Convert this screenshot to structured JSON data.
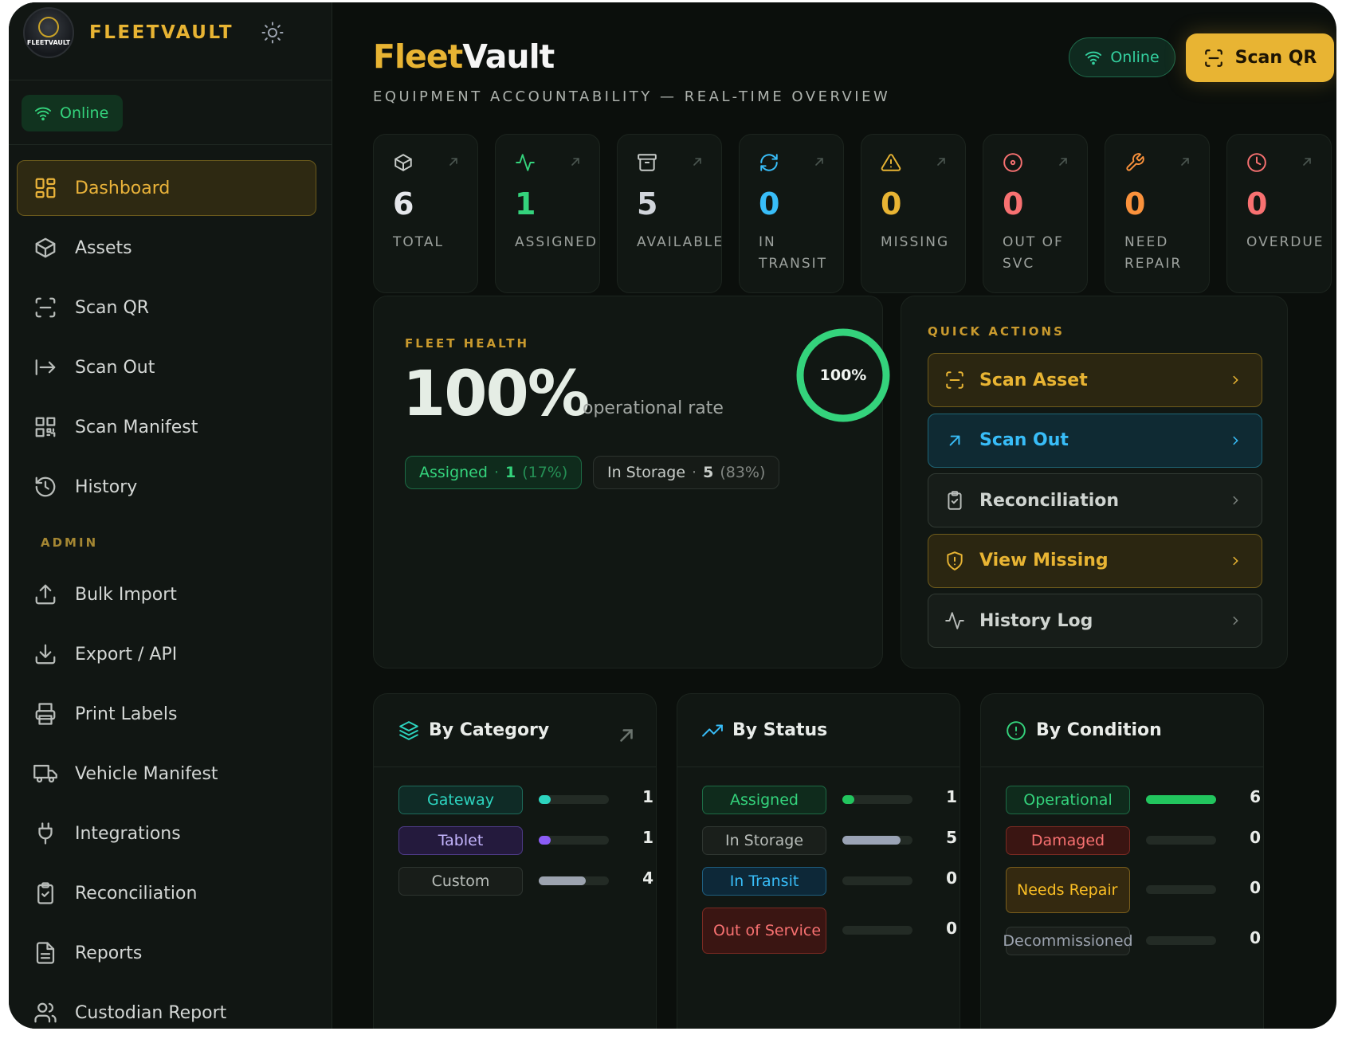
{
  "brand": {
    "name": "FLEETVAULT",
    "logo_text": "FLEETVAULT"
  },
  "sidebar": {
    "status": "Online",
    "items": [
      {
        "label": "Dashboard",
        "icon": "dashboard-icon",
        "active": true
      },
      {
        "label": "Assets",
        "icon": "box-icon"
      },
      {
        "label": "Scan QR",
        "icon": "scan-icon"
      },
      {
        "label": "Scan Out",
        "icon": "arrow-right-bar-icon"
      },
      {
        "label": "Scan Manifest",
        "icon": "qr-icon"
      },
      {
        "label": "History",
        "icon": "history-icon"
      }
    ],
    "admin_label": "ADMIN",
    "admin_items": [
      {
        "label": "Bulk Import",
        "icon": "upload-icon"
      },
      {
        "label": "Export / API",
        "icon": "download-icon"
      },
      {
        "label": "Print Labels",
        "icon": "printer-icon"
      },
      {
        "label": "Vehicle Manifest",
        "icon": "truck-icon"
      },
      {
        "label": "Integrations",
        "icon": "plug-icon"
      },
      {
        "label": "Reconciliation",
        "icon": "clipboard-icon"
      },
      {
        "label": "Reports",
        "icon": "file-icon"
      },
      {
        "label": "Custodian Report",
        "icon": "users-icon"
      }
    ]
  },
  "header": {
    "title_a": "Fleet",
    "title_b": "Vault",
    "subtitle": "EQUIPMENT ACCOUNTABILITY — REAL-TIME OVERVIEW",
    "status": "Online",
    "scan_label": "Scan QR"
  },
  "stats": [
    {
      "value": "6",
      "label": "TOTAL",
      "color": "#e5e7eb",
      "icon": "box-icon"
    },
    {
      "value": "1",
      "label": "ASSIGNED",
      "color": "#34d37c",
      "icon": "activity-icon"
    },
    {
      "value": "5",
      "label": "AVAILABLE",
      "color": "#d1d5db",
      "icon": "archive-icon"
    },
    {
      "value": "0",
      "label": "IN TRANSIT",
      "color": "#38bdf8",
      "icon": "refresh-icon"
    },
    {
      "value": "0",
      "label": "MISSING",
      "color": "#e8b433",
      "icon": "warning-icon"
    },
    {
      "value": "0",
      "label": "OUT OF SVC",
      "color": "#f87171",
      "icon": "target-icon"
    },
    {
      "value": "0",
      "label": "NEED REPAIR",
      "color": "#fb923c",
      "icon": "wrench-icon"
    },
    {
      "value": "0",
      "label": "OVERDUE",
      "color": "#f87171",
      "icon": "clock-icon"
    }
  ],
  "fleet_health": {
    "label": "FLEET HEALTH",
    "value": "100%",
    "sub": "operational rate",
    "ring_label": "100%",
    "ring_fraction": 1.0,
    "assigned": {
      "name": "Assigned",
      "count": "1",
      "pct": "(17%)"
    },
    "storage": {
      "name": "In Storage",
      "count": "5",
      "pct": "(83%)"
    },
    "dot": "·"
  },
  "quick_actions": {
    "label": "QUICK ACTIONS",
    "items": [
      {
        "label": "Scan Asset",
        "icon": "scan-icon",
        "style": "y"
      },
      {
        "label": "Scan Out",
        "icon": "arrow-up-right-icon",
        "style": "b"
      },
      {
        "label": "Reconciliation",
        "icon": "clipboard-icon",
        "style": "n"
      },
      {
        "label": "View Missing",
        "icon": "shield-alert-icon",
        "style": "y"
      },
      {
        "label": "History Log",
        "icon": "activity-icon",
        "style": "n"
      }
    ]
  },
  "by_category": {
    "title": "By Category",
    "rows": [
      {
        "name": "Gateway",
        "count": "1",
        "fraction": 0.17,
        "bg": "#0f2b26",
        "border": "#1e6b5b",
        "color": "#2dd4bf",
        "bar": "#2dd4bf"
      },
      {
        "name": "Tablet",
        "count": "1",
        "fraction": 0.17,
        "bg": "#241a3d",
        "border": "#4c3a85",
        "color": "#c4b5fd",
        "bar": "#8b5cf6"
      },
      {
        "name": "Custom",
        "count": "4",
        "fraction": 0.67,
        "bg": "#181d19",
        "border": "#2e3530",
        "color": "#b8bdb9",
        "bar": "#9ca3af"
      }
    ]
  },
  "by_status": {
    "title": "By Status",
    "rows": [
      {
        "name": "Assigned",
        "count": "1",
        "fraction": 0.17,
        "bg": "#0f2b1c",
        "border": "#1d6b45",
        "color": "#34d37c",
        "bar": "#22c55e"
      },
      {
        "name": "In Storage",
        "count": "5",
        "fraction": 0.83,
        "bg": "#1a1f1b",
        "border": "#2f3631",
        "color": "#b8bdb9",
        "bar": "#9aa3b5"
      },
      {
        "name": "In Transit",
        "count": "0",
        "fraction": 0,
        "bg": "#0d2838",
        "border": "#1f5e80",
        "color": "#38bdf8",
        "bar": "#38bdf8"
      },
      {
        "name": "Out of Service",
        "count": "0",
        "fraction": 0,
        "bg": "#3a1512",
        "border": "#7a2a22",
        "color": "#f87171",
        "bar": "#f87171"
      }
    ]
  },
  "by_condition": {
    "title": "By Condition",
    "rows": [
      {
        "name": "Operational",
        "count": "6",
        "fraction": 1.0,
        "bg": "#0f2b1c",
        "border": "#1d6b45",
        "color": "#34d37c",
        "bar": "#22c55e"
      },
      {
        "name": "Damaged",
        "count": "0",
        "fraction": 0,
        "bg": "#3a1512",
        "border": "#7a2a22",
        "color": "#f87171",
        "bar": "#f87171"
      },
      {
        "name": "Needs Repair",
        "count": "0",
        "fraction": 0,
        "bg": "#342910",
        "border": "#7a5e1c",
        "color": "#fbbf24",
        "bar": "#fbbf24"
      },
      {
        "name": "Decommissioned",
        "count": "0",
        "fraction": 0,
        "bg": "#1a1f1b",
        "border": "#2f3631",
        "color": "#9ca3af",
        "bar": "#9ca3af"
      }
    ]
  }
}
